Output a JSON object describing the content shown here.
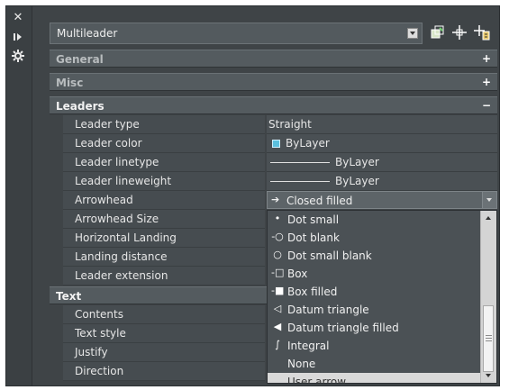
{
  "toolstrip": {
    "icons": [
      "close-icon",
      "pin-icon",
      "properties-icon"
    ]
  },
  "object_selector": {
    "value": "Multileader"
  },
  "toolbar_icons": [
    "quick-select-icon",
    "select-objects-icon",
    "toggle-pickadd-icon"
  ],
  "sections": {
    "general": {
      "title": "General",
      "toggle": "+"
    },
    "misc": {
      "title": "Misc",
      "toggle": "+"
    },
    "leaders": {
      "title": "Leaders",
      "toggle": "−"
    },
    "text": {
      "title": "Text"
    }
  },
  "leaders_props": [
    {
      "label": "Leader type",
      "value": "Straight"
    },
    {
      "label": "Leader color",
      "value": "ByLayer"
    },
    {
      "label": "Leader linetype",
      "value": "ByLayer"
    },
    {
      "label": "Leader lineweight",
      "value": "ByLayer"
    },
    {
      "label": "Arrowhead",
      "value": "Closed filled"
    },
    {
      "label": "Arrowhead Size"
    },
    {
      "label": "Horizontal Landing"
    },
    {
      "label": "Landing distance"
    },
    {
      "label": "Leader extension"
    }
  ],
  "text_props": [
    {
      "label": "Contents"
    },
    {
      "label": "Text style"
    },
    {
      "label": "Justify"
    },
    {
      "label": "Direction"
    }
  ],
  "arrowhead_options": [
    {
      "label": "Dot small",
      "glyph": "•"
    },
    {
      "label": "Dot blank",
      "glyph": "-○"
    },
    {
      "label": "Dot small blank",
      "glyph": "○"
    },
    {
      "label": "Box",
      "glyph": "-□"
    },
    {
      "label": "Box filled",
      "glyph": "-■"
    },
    {
      "label": "Datum triangle",
      "glyph": "◁"
    },
    {
      "label": "Datum triangle filled",
      "glyph": "◀"
    },
    {
      "label": "Integral",
      "glyph": "∫"
    },
    {
      "label": "None",
      "glyph": ""
    },
    {
      "label": "User arrow",
      "glyph": ""
    }
  ],
  "selected_option": "User arrow",
  "colors": {
    "panel_bg": "#3f4447",
    "section_bg": "#545b5f",
    "bylayer_swatch": "#5bc0de",
    "selected_item_bg": "#d9d9d9"
  }
}
